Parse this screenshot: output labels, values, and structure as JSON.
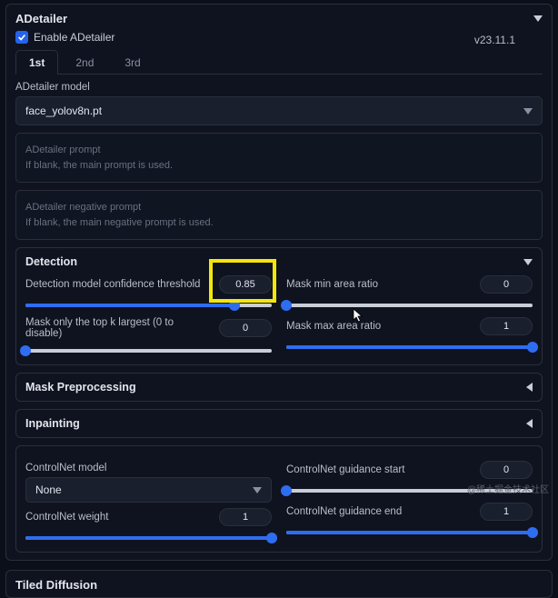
{
  "panel": {
    "title": "ADetailer",
    "enable_label": "Enable ADetailer",
    "enable_checked": true,
    "version": "v23.11.1"
  },
  "tabs": [
    "1st",
    "2nd",
    "3rd"
  ],
  "active_tab": 0,
  "model": {
    "label": "ADetailer model",
    "value": "face_yolov8n.pt"
  },
  "prompt": {
    "placeholder_line1": "ADetailer prompt",
    "placeholder_line2": "If blank, the main prompt is used."
  },
  "neg_prompt": {
    "placeholder_line1": "ADetailer negative prompt",
    "placeholder_line2": "If blank, the main negative prompt is used."
  },
  "detection": {
    "title": "Detection",
    "confidence": {
      "label": "Detection model confidence threshold",
      "value": "0.85",
      "pct": 85
    },
    "topk": {
      "label": "Mask only the top k largest (0 to disable)",
      "value": "0",
      "pct": 0
    },
    "minarea": {
      "label": "Mask min area ratio",
      "value": "0",
      "pct": 0
    },
    "maxarea": {
      "label": "Mask max area ratio",
      "value": "1",
      "pct": 100
    }
  },
  "mask_preprocessing": {
    "title": "Mask Preprocessing"
  },
  "inpainting": {
    "title": "Inpainting"
  },
  "controlnet": {
    "model_label": "ControlNet model",
    "model_value": "None",
    "weight": {
      "label": "ControlNet weight",
      "value": "1",
      "pct": 100
    },
    "gstart": {
      "label": "ControlNet guidance start",
      "value": "0",
      "pct": 0
    },
    "gend": {
      "label": "ControlNet guidance end",
      "value": "1",
      "pct": 100
    }
  },
  "tiled_diffusion": {
    "title": "Tiled Diffusion"
  },
  "watermark": "@稀土掘金技术社区"
}
